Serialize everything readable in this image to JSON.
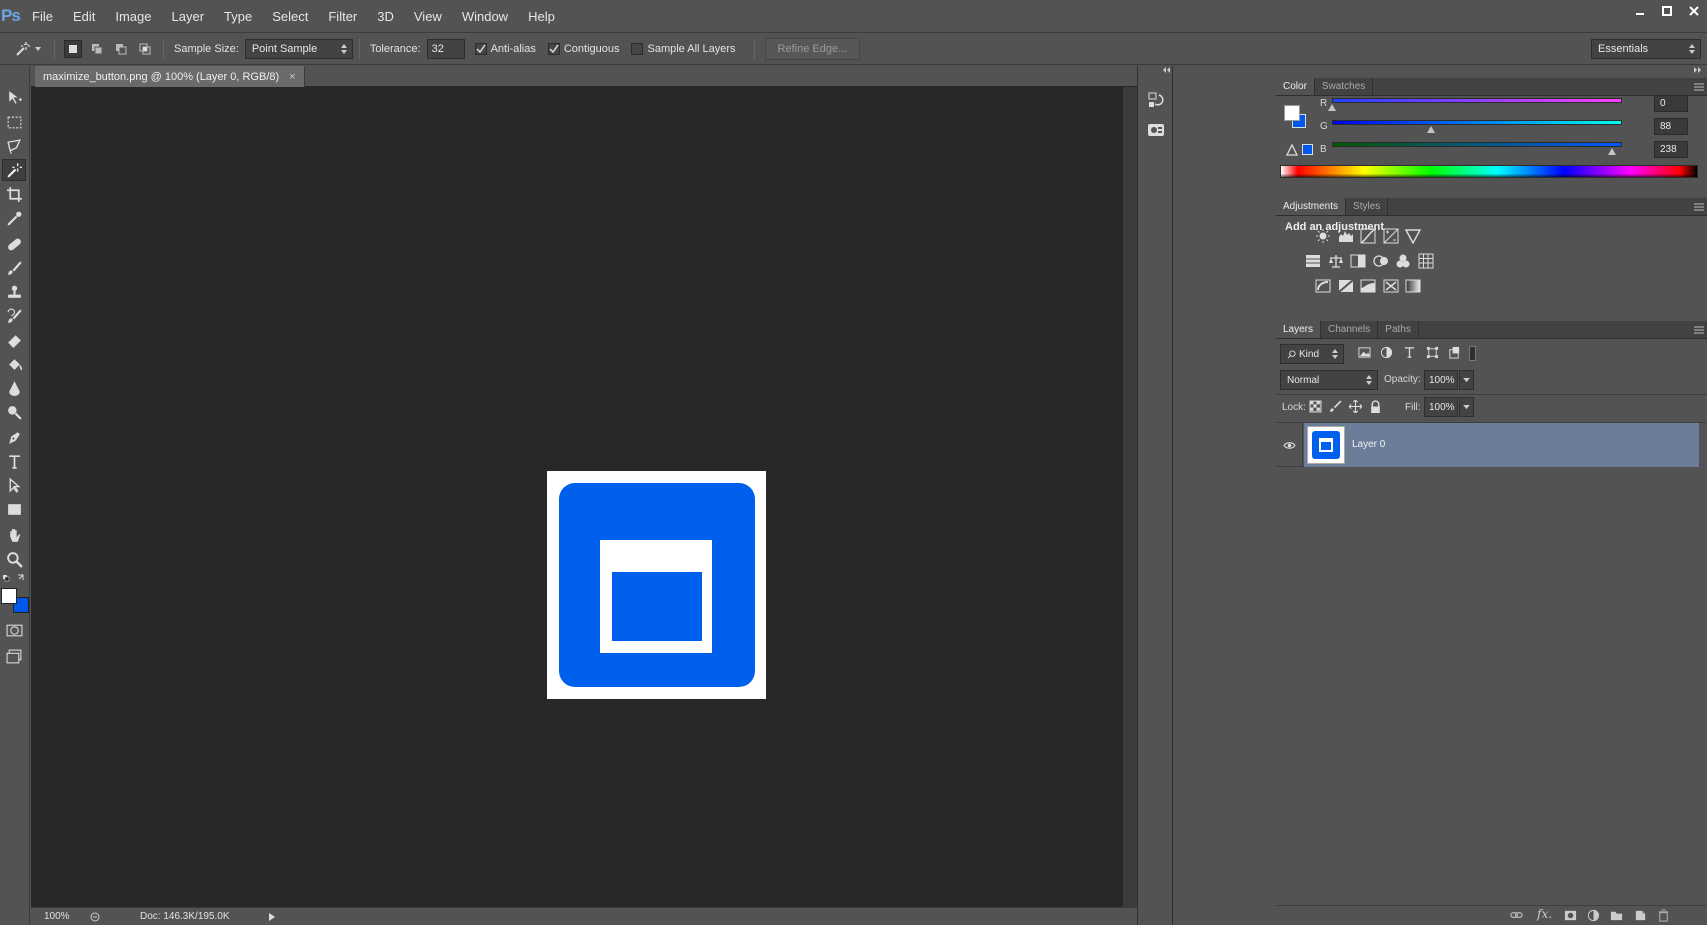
{
  "app": {
    "logo": "Ps"
  },
  "menu": [
    "File",
    "Edit",
    "Image",
    "Layer",
    "Type",
    "Select",
    "Filter",
    "3D",
    "View",
    "Window",
    "Help"
  ],
  "options": {
    "sample_size_label": "Sample Size:",
    "sample_size_value": "Point Sample",
    "tolerance_label": "Tolerance:",
    "tolerance_value": "32",
    "anti_alias": {
      "label": "Anti-alias",
      "checked": true
    },
    "contiguous": {
      "label": "Contiguous",
      "checked": true
    },
    "sample_all_layers": {
      "label": "Sample All Layers",
      "checked": false
    },
    "refine_edge": "Refine Edge...",
    "workspace": "Essentials"
  },
  "document": {
    "tab_title": "maximize_button.png @ 100% (Layer 0, RGB/8)",
    "tab_close": "×",
    "zoom": "100%",
    "doc_size": "Doc: 146.3K/195.0K"
  },
  "colors": {
    "foreground": "#ffffff",
    "background": "#0058ee",
    "image_blue": "#0060ee",
    "canvas": "#282828",
    "panel": "#535353"
  },
  "color_panel": {
    "tabs": [
      "Color",
      "Swatches"
    ],
    "channels": [
      {
        "label": "R",
        "value": "0"
      },
      {
        "label": "G",
        "value": "88"
      },
      {
        "label": "B",
        "value": "238"
      }
    ]
  },
  "adjustments_panel": {
    "tabs": [
      "Adjustments",
      "Styles"
    ],
    "heading": "Add an adjustment",
    "icons_row1": [
      "brightness-contrast-icon",
      "levels-icon",
      "curves-icon",
      "exposure-icon",
      "vibrance-icon"
    ],
    "icons_row2": [
      "hue-saturation-icon",
      "color-balance-icon",
      "black-white-icon",
      "photo-filter-icon",
      "channel-mixer-icon",
      "color-lookup-icon"
    ],
    "icons_row3": [
      "invert-icon",
      "posterize-icon",
      "threshold-icon",
      "selective-color-icon",
      "gradient-map-icon"
    ]
  },
  "layers_panel": {
    "tabs": [
      "Layers",
      "Channels",
      "Paths"
    ],
    "filter_kind": "Kind",
    "blend_mode": "Normal",
    "opacity_label": "Opacity:",
    "opacity_value": "100%",
    "lock_label": "Lock:",
    "fill_label": "Fill:",
    "fill_value": "100%",
    "layers": [
      {
        "name": "Layer 0",
        "visible": true,
        "selected": true
      }
    ]
  }
}
